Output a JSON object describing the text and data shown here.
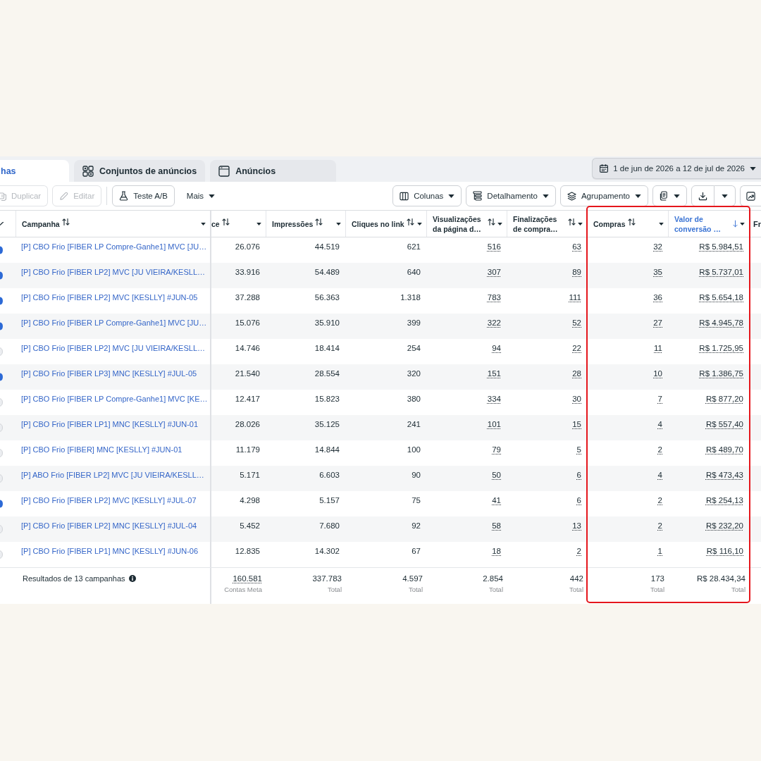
{
  "tabs": [
    {
      "label": "has",
      "kind": "campaigns",
      "selected": true
    },
    {
      "label": "Conjuntos de anúncios",
      "kind": "ad-sets",
      "selected": false
    },
    {
      "label": "Anúncios",
      "kind": "ads",
      "selected": false
    }
  ],
  "date_range": {
    "label": "1 de jun de 2026 a 12 de jul de 2026"
  },
  "toolbar": {
    "groups": [
      {
        "items": [
          {
            "label": "Duplicar",
            "kind": "duplicate",
            "disabled": true
          },
          {
            "label": "Editar",
            "kind": "edit",
            "disabled": true
          }
        ]
      },
      {
        "items": [
          {
            "label": "Teste A/B",
            "kind": "ab-test",
            "disabled": false
          },
          {
            "label": "Mais",
            "kind": "menu",
            "disabled": false
          }
        ]
      }
    ],
    "right": [
      {
        "label": "Colunas",
        "kind": "columns"
      },
      {
        "label": "Detalhamento",
        "kind": "breakdown"
      },
      {
        "label": "Agrupamento",
        "kind": "grouping"
      },
      {
        "kind": "reports"
      },
      {
        "kind": "export"
      },
      {
        "kind": "chart"
      }
    ]
  },
  "table": {
    "columns": [
      {
        "label": "Campanha",
        "sorted": false,
        "underlined": false,
        "highlighted": false
      },
      {
        "label": "ce",
        "sorted": false,
        "underlined": false,
        "highlighted": false
      },
      {
        "label": "Impressões",
        "sorted": false,
        "underlined": false,
        "highlighted": false
      },
      {
        "label": "Cliques no link",
        "sorted": false,
        "underlined": false,
        "highlighted": false
      },
      {
        "label": "Visualizações da página d…",
        "sorted": false,
        "underlined": true,
        "highlighted": false
      },
      {
        "label": "Finalizações de compra…",
        "sorted": false,
        "underlined": true,
        "highlighted": false
      },
      {
        "label": "Compras",
        "sorted": false,
        "underlined": true,
        "highlighted": true
      },
      {
        "label": "Valor de conversão …",
        "sorted": true,
        "underlined": true,
        "highlighted": true
      }
    ],
    "cut_column": {
      "label": "Fr"
    },
    "rows": [
      {
        "on": true,
        "cells": [
          "[P] CBO Frio [FIBER LP Compre-Ganhe1] MVC [JU…",
          "26.076",
          "44.519",
          "621",
          "516",
          "63",
          "32",
          "R$ 5.984,51"
        ]
      },
      {
        "on": true,
        "cells": [
          "[P] CBO Frio [FIBER LP2] MVC [JU VIEIRA/KESLL…",
          "33.916",
          "54.489",
          "640",
          "307",
          "89",
          "35",
          "R$ 5.737,01"
        ]
      },
      {
        "on": true,
        "cells": [
          "[P] CBO Frio [FIBER LP2] MVC [KESLLY] #JUN-05",
          "37.288",
          "56.363",
          "1.318",
          "783",
          "111",
          "36",
          "R$ 5.654,18"
        ]
      },
      {
        "on": true,
        "cells": [
          "[P] CBO Frio [FIBER LP Compre-Ganhe1] MVC [JU…",
          "15.076",
          "35.910",
          "399",
          "322",
          "52",
          "27",
          "R$ 4.945,78"
        ]
      },
      {
        "on": false,
        "cells": [
          "[P] CBO Frio [FIBER LP2] MVC [JU VIEIRA/KESLL…",
          "14.746",
          "18.414",
          "254",
          "94",
          "22",
          "11",
          "R$ 1.725,95"
        ]
      },
      {
        "on": true,
        "cells": [
          "[P] CBO Frio [FIBER LP3] MNC [KESLLY] #JUL-05",
          "21.540",
          "28.554",
          "320",
          "151",
          "28",
          "10",
          "R$ 1.386,75"
        ]
      },
      {
        "on": false,
        "cells": [
          "[P] CBO Frio [FIBER LP Compre-Ganhe1] MVC [KE…",
          "12.417",
          "15.823",
          "380",
          "334",
          "30",
          "7",
          "R$ 877,20"
        ]
      },
      {
        "on": false,
        "cells": [
          "[P] CBO Frio [FIBER LP1] MNC [KESLLY] #JUN-01",
          "28.026",
          "35.125",
          "241",
          "101",
          "15",
          "4",
          "R$ 557,40"
        ]
      },
      {
        "on": false,
        "cells": [
          "[P] CBO Frio [FIBER] MNC [KESLLY] #JUN-01",
          "11.179",
          "14.844",
          "100",
          "79",
          "5",
          "2",
          "R$ 489,70"
        ]
      },
      {
        "on": false,
        "cells": [
          "[P] ABO Frio [FIBER LP2] MVC [JU VIEIRA/KESLL…",
          "5.171",
          "6.603",
          "90",
          "50",
          "6",
          "4",
          "R$ 473,43"
        ]
      },
      {
        "on": true,
        "cells": [
          "[P] CBO Frio [FIBER LP2] MVC [KESLLY] #JUL-07",
          "4.298",
          "5.157",
          "75",
          "41",
          "6",
          "2",
          "R$ 254,13"
        ]
      },
      {
        "on": false,
        "cells": [
          "[P] CBO Frio [FIBER LP2] MNC [KESLLY] #JUL-04",
          "5.452",
          "7.680",
          "92",
          "58",
          "13",
          "2",
          "R$ 232,20"
        ]
      },
      {
        "on": false,
        "cells": [
          "[P] CBO Frio [FIBER LP1] MNC [KESLLY] #JUN-06",
          "12.835",
          "14.302",
          "67",
          "18",
          "2",
          "1",
          "R$ 116,10"
        ]
      }
    ],
    "footer": {
      "label": "Resultados de 13 campanhas",
      "totals": [
        {
          "value": "160.581",
          "note": "Contas Meta",
          "underlined": true
        },
        {
          "value": "337.783",
          "note": "Total",
          "underlined": false
        },
        {
          "value": "4.597",
          "note": "Total",
          "underlined": false
        },
        {
          "value": "2.854",
          "note": "Total",
          "underlined": false
        },
        {
          "value": "442",
          "note": "Total",
          "underlined": false
        },
        {
          "value": "173",
          "note": "Total",
          "underlined": false
        },
        {
          "value": "R$ 28.434,34",
          "note": "Total",
          "underlined": false
        }
      ]
    }
  }
}
